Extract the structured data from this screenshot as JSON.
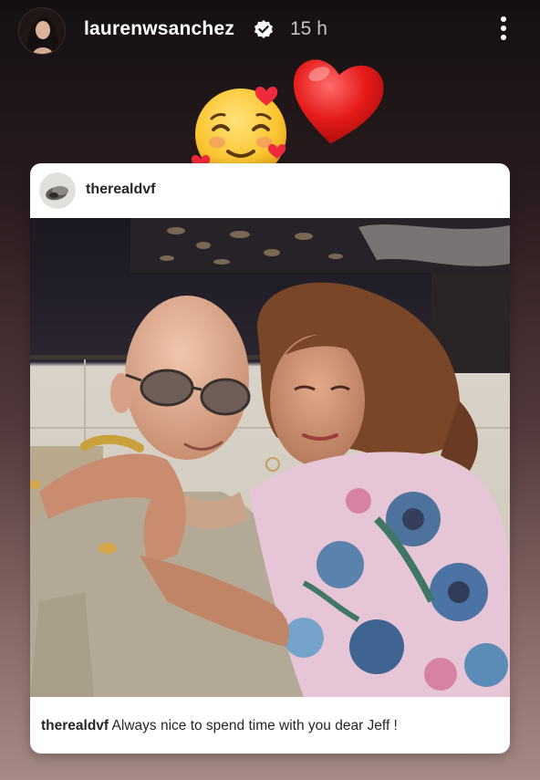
{
  "story": {
    "username": "laurenwsanchez",
    "time_ago": "15 h",
    "verified_icon": "verified-badge-icon",
    "more_icon": "more-vertical-icon"
  },
  "stickers": [
    {
      "name": "smiling-face-with-hearts-emoji"
    },
    {
      "name": "red-heart-emoji"
    }
  ],
  "shared_post": {
    "username": "therealdvf",
    "caption_username": "therealdvf",
    "caption_text": "Always nice to spend time with you dear Jeff !"
  },
  "colors": {
    "background_top": "#141012",
    "background_bottom": "#a58a85",
    "card": "#ffffff",
    "text_dark": "#262626"
  }
}
